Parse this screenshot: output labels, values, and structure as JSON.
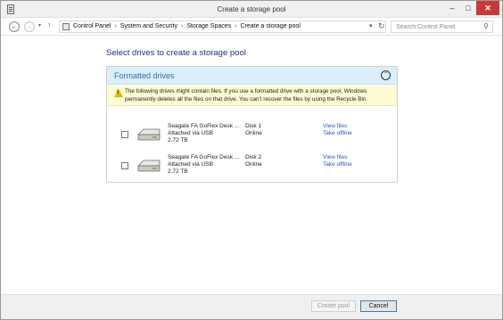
{
  "window": {
    "title": "Create a storage pool",
    "controls": {
      "minimize": "–",
      "maximize": "□",
      "close": "✕"
    }
  },
  "address_bar": {
    "back_icon": "←",
    "forward_icon": "→",
    "recent_icon": "▾",
    "up_icon": "↑",
    "breadcrumbs": [
      "Control Panel",
      "System and Security",
      "Storage Spaces",
      "Create a storage pool"
    ],
    "separator": "›",
    "dropdown_icon": "▾",
    "refresh_icon": "↻",
    "search_placeholder": "Search Control Panel",
    "search_icon": "⚲"
  },
  "main": {
    "heading": "Select drives to create a storage pool",
    "panel": {
      "title": "Formatted drives",
      "collapse_icon": "⌃",
      "warning_text": "The following drives might contain files. If you use a formatted drive with a storage pool, Windows permanently deletes all the files on that drive. You can't recover the files by using the Recycle Bin.",
      "warning_glyph": "!",
      "drives": [
        {
          "name": "Seagate FA GoFlex Desk ...",
          "connection": "Attached via USB",
          "size": "2.72 TB",
          "disk": "Disk 1",
          "status": "Online",
          "view_files": "View files",
          "take_offline": "Take offline"
        },
        {
          "name": "Seagate FA GoFlex Desk ...",
          "connection": "Attached via USB",
          "size": "2.72 TB",
          "disk": "Disk 2",
          "status": "Online",
          "view_files": "View files",
          "take_offline": "Take offline"
        }
      ]
    }
  },
  "footer": {
    "create_pool": "Create pool",
    "cancel": "Cancel"
  },
  "colors": {
    "heading": "#1e3287",
    "panel_header_bg": "#dceefa",
    "panel_title": "#2a6fb3",
    "warning_bg": "#fdfbd3",
    "link": "#1f5cb4",
    "close_button": "#c73a3a"
  }
}
